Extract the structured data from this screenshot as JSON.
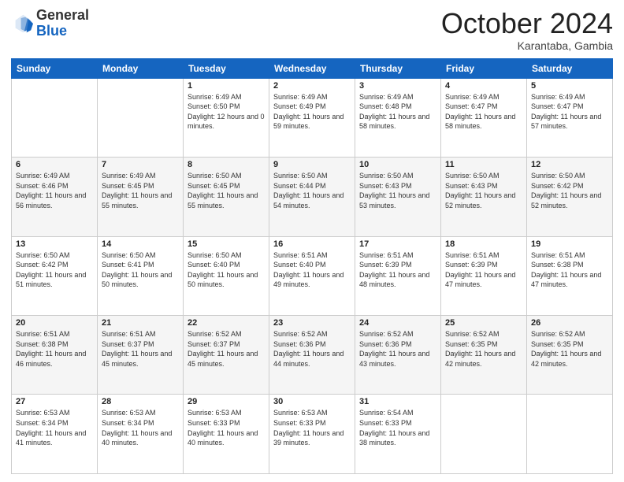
{
  "header": {
    "logo_general": "General",
    "logo_blue": "Blue",
    "month": "October 2024",
    "location": "Karantaba, Gambia"
  },
  "weekdays": [
    "Sunday",
    "Monday",
    "Tuesday",
    "Wednesday",
    "Thursday",
    "Friday",
    "Saturday"
  ],
  "weeks": [
    [
      {
        "day": "",
        "sunrise": "",
        "sunset": "",
        "daylight": ""
      },
      {
        "day": "",
        "sunrise": "",
        "sunset": "",
        "daylight": ""
      },
      {
        "day": "1",
        "sunrise": "Sunrise: 6:49 AM",
        "sunset": "Sunset: 6:50 PM",
        "daylight": "Daylight: 12 hours and 0 minutes."
      },
      {
        "day": "2",
        "sunrise": "Sunrise: 6:49 AM",
        "sunset": "Sunset: 6:49 PM",
        "daylight": "Daylight: 11 hours and 59 minutes."
      },
      {
        "day": "3",
        "sunrise": "Sunrise: 6:49 AM",
        "sunset": "Sunset: 6:48 PM",
        "daylight": "Daylight: 11 hours and 58 minutes."
      },
      {
        "day": "4",
        "sunrise": "Sunrise: 6:49 AM",
        "sunset": "Sunset: 6:47 PM",
        "daylight": "Daylight: 11 hours and 58 minutes."
      },
      {
        "day": "5",
        "sunrise": "Sunrise: 6:49 AM",
        "sunset": "Sunset: 6:47 PM",
        "daylight": "Daylight: 11 hours and 57 minutes."
      }
    ],
    [
      {
        "day": "6",
        "sunrise": "Sunrise: 6:49 AM",
        "sunset": "Sunset: 6:46 PM",
        "daylight": "Daylight: 11 hours and 56 minutes."
      },
      {
        "day": "7",
        "sunrise": "Sunrise: 6:49 AM",
        "sunset": "Sunset: 6:45 PM",
        "daylight": "Daylight: 11 hours and 55 minutes."
      },
      {
        "day": "8",
        "sunrise": "Sunrise: 6:50 AM",
        "sunset": "Sunset: 6:45 PM",
        "daylight": "Daylight: 11 hours and 55 minutes."
      },
      {
        "day": "9",
        "sunrise": "Sunrise: 6:50 AM",
        "sunset": "Sunset: 6:44 PM",
        "daylight": "Daylight: 11 hours and 54 minutes."
      },
      {
        "day": "10",
        "sunrise": "Sunrise: 6:50 AM",
        "sunset": "Sunset: 6:43 PM",
        "daylight": "Daylight: 11 hours and 53 minutes."
      },
      {
        "day": "11",
        "sunrise": "Sunrise: 6:50 AM",
        "sunset": "Sunset: 6:43 PM",
        "daylight": "Daylight: 11 hours and 52 minutes."
      },
      {
        "day": "12",
        "sunrise": "Sunrise: 6:50 AM",
        "sunset": "Sunset: 6:42 PM",
        "daylight": "Daylight: 11 hours and 52 minutes."
      }
    ],
    [
      {
        "day": "13",
        "sunrise": "Sunrise: 6:50 AM",
        "sunset": "Sunset: 6:42 PM",
        "daylight": "Daylight: 11 hours and 51 minutes."
      },
      {
        "day": "14",
        "sunrise": "Sunrise: 6:50 AM",
        "sunset": "Sunset: 6:41 PM",
        "daylight": "Daylight: 11 hours and 50 minutes."
      },
      {
        "day": "15",
        "sunrise": "Sunrise: 6:50 AM",
        "sunset": "Sunset: 6:40 PM",
        "daylight": "Daylight: 11 hours and 50 minutes."
      },
      {
        "day": "16",
        "sunrise": "Sunrise: 6:51 AM",
        "sunset": "Sunset: 6:40 PM",
        "daylight": "Daylight: 11 hours and 49 minutes."
      },
      {
        "day": "17",
        "sunrise": "Sunrise: 6:51 AM",
        "sunset": "Sunset: 6:39 PM",
        "daylight": "Daylight: 11 hours and 48 minutes."
      },
      {
        "day": "18",
        "sunrise": "Sunrise: 6:51 AM",
        "sunset": "Sunset: 6:39 PM",
        "daylight": "Daylight: 11 hours and 47 minutes."
      },
      {
        "day": "19",
        "sunrise": "Sunrise: 6:51 AM",
        "sunset": "Sunset: 6:38 PM",
        "daylight": "Daylight: 11 hours and 47 minutes."
      }
    ],
    [
      {
        "day": "20",
        "sunrise": "Sunrise: 6:51 AM",
        "sunset": "Sunset: 6:38 PM",
        "daylight": "Daylight: 11 hours and 46 minutes."
      },
      {
        "day": "21",
        "sunrise": "Sunrise: 6:51 AM",
        "sunset": "Sunset: 6:37 PM",
        "daylight": "Daylight: 11 hours and 45 minutes."
      },
      {
        "day": "22",
        "sunrise": "Sunrise: 6:52 AM",
        "sunset": "Sunset: 6:37 PM",
        "daylight": "Daylight: 11 hours and 45 minutes."
      },
      {
        "day": "23",
        "sunrise": "Sunrise: 6:52 AM",
        "sunset": "Sunset: 6:36 PM",
        "daylight": "Daylight: 11 hours and 44 minutes."
      },
      {
        "day": "24",
        "sunrise": "Sunrise: 6:52 AM",
        "sunset": "Sunset: 6:36 PM",
        "daylight": "Daylight: 11 hours and 43 minutes."
      },
      {
        "day": "25",
        "sunrise": "Sunrise: 6:52 AM",
        "sunset": "Sunset: 6:35 PM",
        "daylight": "Daylight: 11 hours and 42 minutes."
      },
      {
        "day": "26",
        "sunrise": "Sunrise: 6:52 AM",
        "sunset": "Sunset: 6:35 PM",
        "daylight": "Daylight: 11 hours and 42 minutes."
      }
    ],
    [
      {
        "day": "27",
        "sunrise": "Sunrise: 6:53 AM",
        "sunset": "Sunset: 6:34 PM",
        "daylight": "Daylight: 11 hours and 41 minutes."
      },
      {
        "day": "28",
        "sunrise": "Sunrise: 6:53 AM",
        "sunset": "Sunset: 6:34 PM",
        "daylight": "Daylight: 11 hours and 40 minutes."
      },
      {
        "day": "29",
        "sunrise": "Sunrise: 6:53 AM",
        "sunset": "Sunset: 6:33 PM",
        "daylight": "Daylight: 11 hours and 40 minutes."
      },
      {
        "day": "30",
        "sunrise": "Sunrise: 6:53 AM",
        "sunset": "Sunset: 6:33 PM",
        "daylight": "Daylight: 11 hours and 39 minutes."
      },
      {
        "day": "31",
        "sunrise": "Sunrise: 6:54 AM",
        "sunset": "Sunset: 6:33 PM",
        "daylight": "Daylight: 11 hours and 38 minutes."
      },
      {
        "day": "",
        "sunrise": "",
        "sunset": "",
        "daylight": ""
      },
      {
        "day": "",
        "sunrise": "",
        "sunset": "",
        "daylight": ""
      }
    ]
  ]
}
